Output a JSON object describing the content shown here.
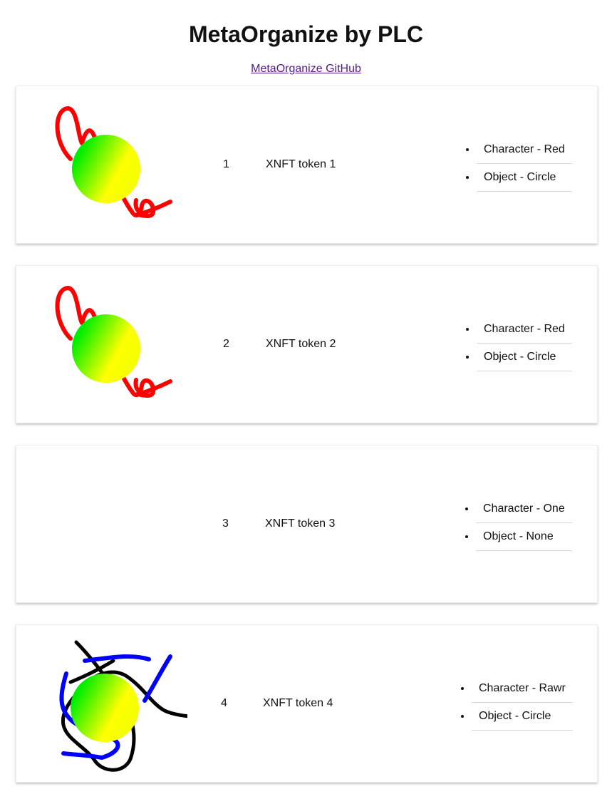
{
  "header": {
    "title": "MetaOrganize by PLC",
    "github_link_label": "MetaOrganize GitHub"
  },
  "tokens": [
    {
      "number": "1",
      "name": "XNFT token 1",
      "traits": [
        "Character - Red",
        "Object - Circle"
      ],
      "artwork": "red-scribble-with-gradient-circle"
    },
    {
      "number": "2",
      "name": "XNFT token 2",
      "traits": [
        "Character - Red",
        "Object - Circle"
      ],
      "artwork": "red-scribble-with-gradient-circle"
    },
    {
      "number": "3",
      "name": "XNFT token 3",
      "traits": [
        "Character - One",
        "Object - None"
      ],
      "artwork": "none"
    },
    {
      "number": "4",
      "name": "XNFT token 4",
      "traits": [
        "Character - Rawr",
        "Object - Circle"
      ],
      "artwork": "black-blue-scribble-with-gradient-circle"
    }
  ],
  "colors": {
    "link": "#551a8b",
    "scribble_red": "#ff0000",
    "scribble_blue": "#0000ff",
    "scribble_black": "#000000",
    "circle_gradient_start": "#00ee00",
    "circle_gradient_end": "#ffff00"
  }
}
